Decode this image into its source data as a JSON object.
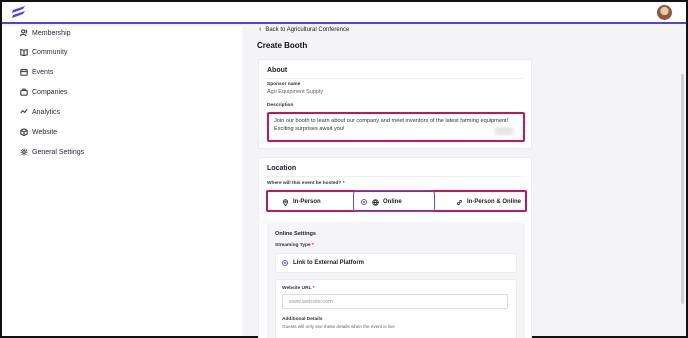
{
  "nav": {
    "items": [
      {
        "label": "Membership",
        "icon": "users-icon"
      },
      {
        "label": "Community",
        "icon": "book-icon"
      },
      {
        "label": "Events",
        "icon": "calendar-icon"
      },
      {
        "label": "Companies",
        "icon": "briefcase-icon"
      },
      {
        "label": "Analytics",
        "icon": "chart-icon"
      },
      {
        "label": "Website",
        "icon": "cube-icon"
      },
      {
        "label": "General Settings",
        "icon": "gear-icon"
      }
    ]
  },
  "header": {
    "back_label": "Back to Agricultural Conference",
    "title": "Create Booth"
  },
  "about": {
    "title": "About",
    "sponsor_label": "Sponsor name",
    "sponsor_value": "Agri Equipment Supply",
    "description_label": "Description",
    "description_line1": "Join our booth to learn about our company and meet inventors of the latest farming equipment!",
    "description_line2": "Exciting surprises await you!"
  },
  "location": {
    "title": "Location",
    "hosted_label": "Where will this event be hosted?",
    "required_mark": "*",
    "options": [
      {
        "label": "In-Person",
        "icon": "map-pin-icon"
      },
      {
        "label": "Online",
        "icon": "globe-icon",
        "selected": true
      },
      {
        "label": "In-Person & Online",
        "icon": "link-icon"
      }
    ],
    "online_settings": {
      "title": "Online Settings",
      "streaming_label": "Streaming Type",
      "streaming_option": "Link to External Platform",
      "url_label": "Website URL",
      "url_placeholder": "www.website.com",
      "details_label": "Additional Details",
      "details_note": "Guests will only see these details when the event is live"
    }
  },
  "colors": {
    "accent": "#6b4fd8",
    "highlight": "#c2185b"
  }
}
